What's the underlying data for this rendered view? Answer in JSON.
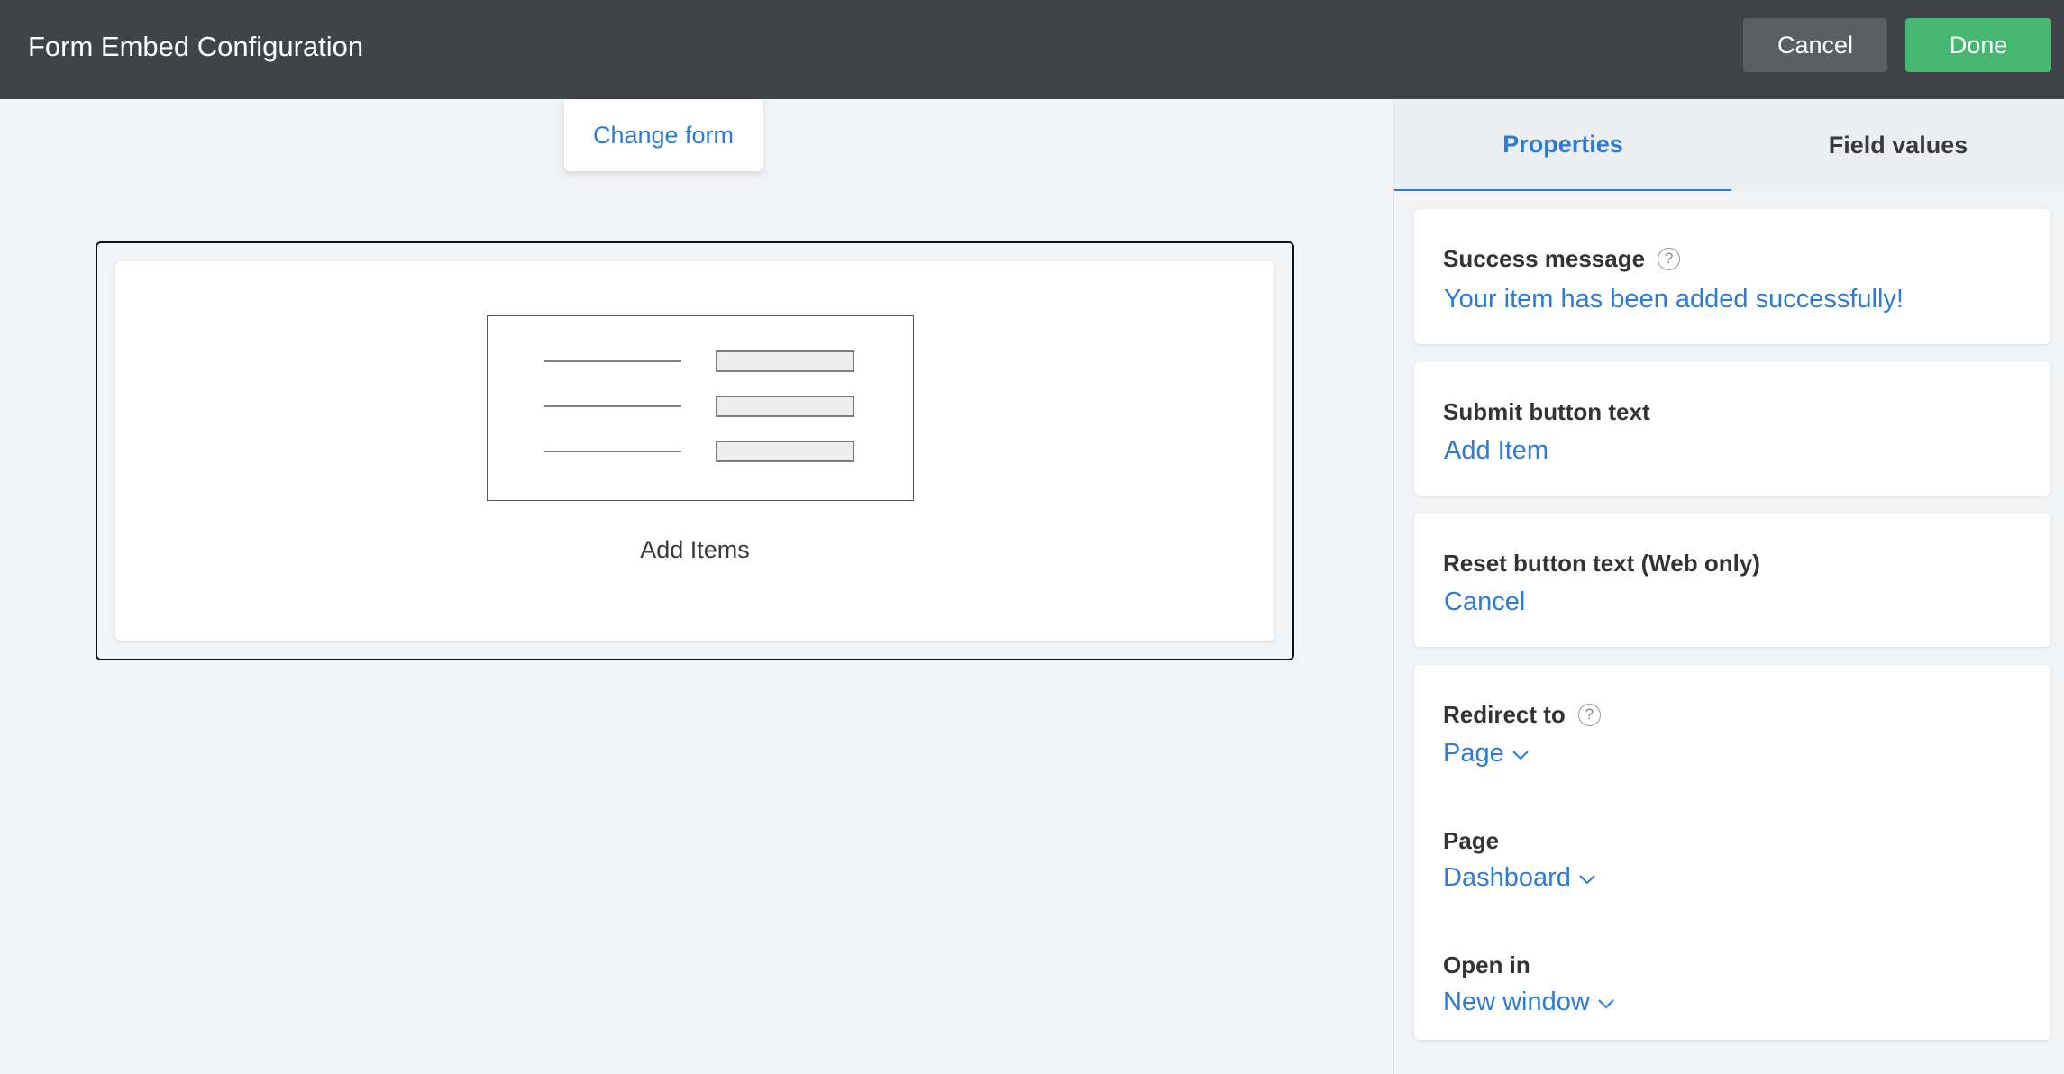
{
  "header": {
    "title": "Form Embed Configuration",
    "cancel_label": "Cancel",
    "done_label": "Done"
  },
  "canvas": {
    "change_form_label": "Change form",
    "embed_name": "Add Items"
  },
  "panel": {
    "tabs": [
      {
        "label": "Properties",
        "active": true
      },
      {
        "label": "Field values",
        "active": false
      }
    ],
    "success_message": {
      "label": "Success message",
      "value": "Your item has been added successfully!"
    },
    "submit_button_text": {
      "label": "Submit button text",
      "value": "Add Item"
    },
    "reset_button_text": {
      "label": "Reset button text (Web only)",
      "value": "Cancel"
    },
    "redirect_to": {
      "label": "Redirect to",
      "value": "Page"
    },
    "page": {
      "label": "Page",
      "value": "Dashboard"
    },
    "open_in": {
      "label": "Open in",
      "value": "New window"
    }
  },
  "colors": {
    "header_bg": "#40434a",
    "accent_blue": "#2e7bd3",
    "done_green": "#46b771",
    "cancel_gray": "#5b5e63"
  }
}
